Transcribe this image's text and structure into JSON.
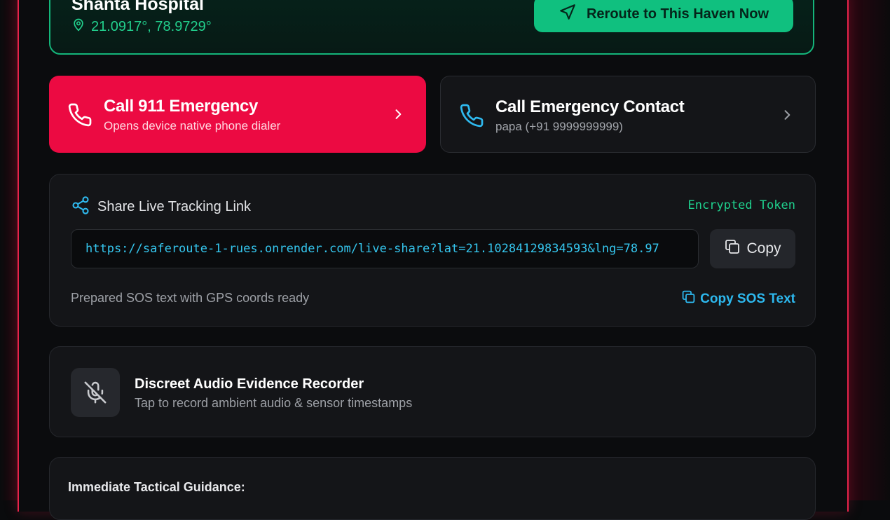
{
  "haven": {
    "name": "Shanta Hospital",
    "coords": "21.0917°, 78.9729°",
    "reroute_label": "Reroute to This Haven Now"
  },
  "emergency_call": {
    "title": "Call 911 Emergency",
    "subtitle": "Opens device native phone dialer"
  },
  "contact_call": {
    "title": "Call Emergency Contact",
    "subtitle": "papa (+91 9999999999)"
  },
  "share": {
    "title": "Share Live Tracking Link",
    "token_label": "Encrypted Token",
    "link": "https://saferoute-1-rues.onrender.com/live-share?lat=21.10284129834593&lng=78.97",
    "copy_label": "Copy",
    "sos_note": "Prepared SOS text with GPS coords ready",
    "copy_sos_label": "Copy SOS Text"
  },
  "audio": {
    "title": "Discreet Audio Evidence Recorder",
    "subtitle": "Tap to record ambient audio & sensor timestamps"
  },
  "guidance": {
    "title": "Immediate Tactical Guidance:"
  },
  "colors": {
    "accent_red": "#ec0a42",
    "accent_green": "#10c07f",
    "link_cyan": "#35c6ee"
  }
}
